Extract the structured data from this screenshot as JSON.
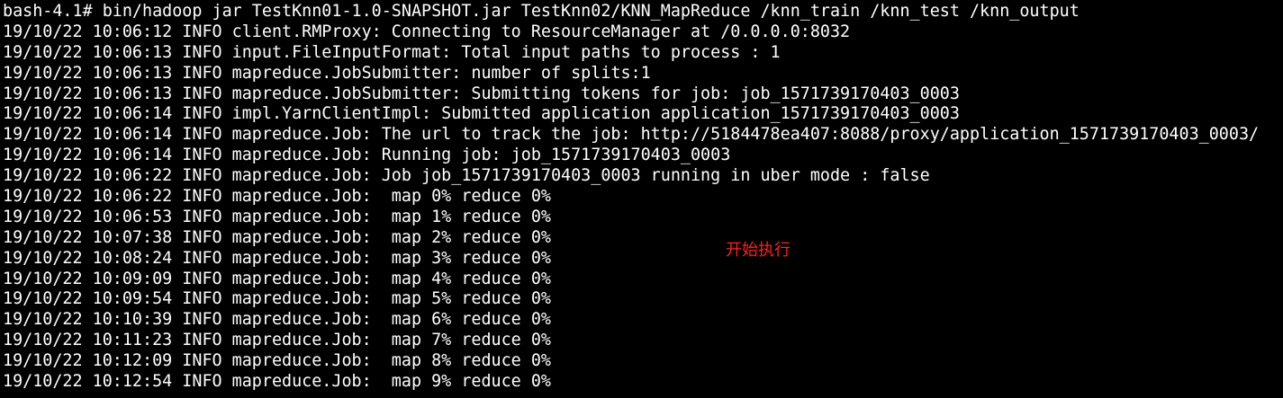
{
  "terminal": {
    "lines": [
      "bash-4.1# bin/hadoop jar TestKnn01-1.0-SNAPSHOT.jar TestKnn02/KNN_MapReduce /knn_train /knn_test /knn_output",
      "19/10/22 10:06:12 INFO client.RMProxy: Connecting to ResourceManager at /0.0.0.0:8032",
      "19/10/22 10:06:13 INFO input.FileInputFormat: Total input paths to process : 1",
      "19/10/22 10:06:13 INFO mapreduce.JobSubmitter: number of splits:1",
      "19/10/22 10:06:13 INFO mapreduce.JobSubmitter: Submitting tokens for job: job_1571739170403_0003",
      "19/10/22 10:06:14 INFO impl.YarnClientImpl: Submitted application application_1571739170403_0003",
      "19/10/22 10:06:14 INFO mapreduce.Job: The url to track the job: http://5184478ea407:8088/proxy/application_1571739170403_0003/",
      "19/10/22 10:06:14 INFO mapreduce.Job: Running job: job_1571739170403_0003",
      "19/10/22 10:06:22 INFO mapreduce.Job: Job job_1571739170403_0003 running in uber mode : false",
      "19/10/22 10:06:22 INFO mapreduce.Job:  map 0% reduce 0%",
      "19/10/22 10:06:53 INFO mapreduce.Job:  map 1% reduce 0%",
      "19/10/22 10:07:38 INFO mapreduce.Job:  map 2% reduce 0%",
      "19/10/22 10:08:24 INFO mapreduce.Job:  map 3% reduce 0%",
      "19/10/22 10:09:09 INFO mapreduce.Job:  map 4% reduce 0%",
      "19/10/22 10:09:54 INFO mapreduce.Job:  map 5% reduce 0%",
      "19/10/22 10:10:39 INFO mapreduce.Job:  map 6% reduce 0%",
      "19/10/22 10:11:23 INFO mapreduce.Job:  map 7% reduce 0%",
      "19/10/22 10:12:09 INFO mapreduce.Job:  map 8% reduce 0%",
      "19/10/22 10:12:54 INFO mapreduce.Job:  map 9% reduce 0%"
    ]
  },
  "annotation": {
    "text": "开始执行"
  },
  "colors": {
    "background": "#000000",
    "text": "#ffffff",
    "annotation": "#ff2020"
  }
}
